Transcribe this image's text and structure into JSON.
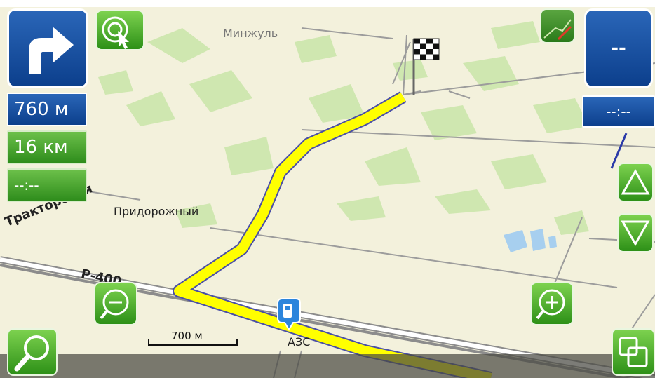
{
  "map": {
    "labels": {
      "town_north": "Минжуль",
      "town_middle": "Придорожный",
      "road_name": "Тракторовая",
      "road_code": "Р-400",
      "poi_fuel": "АЗС"
    },
    "scale_label": "700 м"
  },
  "maneuver": {
    "icon": "turn-right-arrow-icon",
    "distance_to_turn": "760 м"
  },
  "route": {
    "remaining_distance": "16 км",
    "arrival_time": "--:--"
  },
  "right_panel": {
    "speed": "--",
    "time": "--:--"
  },
  "icons": {
    "locate": "target-cursor-icon",
    "route_map": "route-map-icon",
    "tilt_up": "triangle-up-icon",
    "tilt_down": "triangle-down-icon",
    "zoom_in": "plus-circle-icon",
    "zoom_out": "minus-circle-icon",
    "search": "magnifier-icon",
    "menu": "windows-icon",
    "finish": "checkered-flag-icon",
    "fuel": "fuel-station-icon"
  },
  "colors": {
    "route": "#ffff00",
    "route_outline": "#4a4fa6",
    "map_bg": "#f3f1dc",
    "vegetation": "#cfe7b0",
    "water": "#a7cfef",
    "blue_panel": "#0c3f8c",
    "green_panel": "#2f8d1c"
  }
}
